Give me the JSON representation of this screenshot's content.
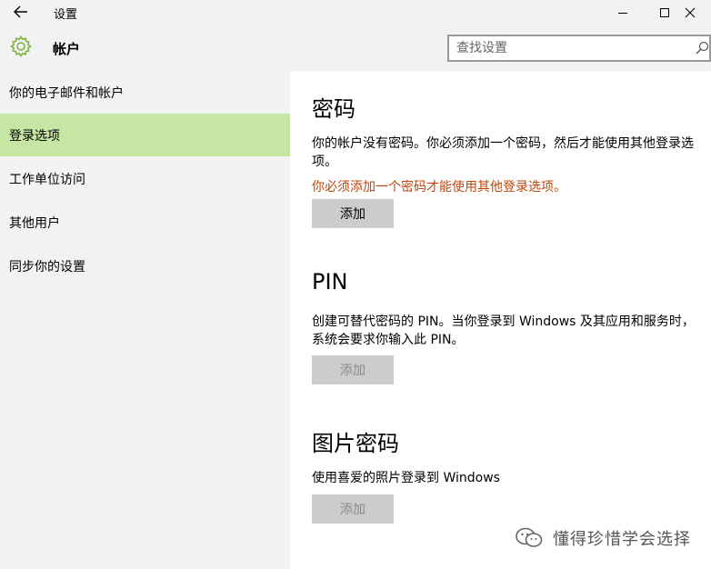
{
  "window": {
    "title": "设置"
  },
  "header": {
    "title": "帐户",
    "search_placeholder": "查找设置"
  },
  "sidebar": {
    "items": [
      {
        "label": "你的电子邮件和帐户",
        "selected": false
      },
      {
        "label": "登录选项",
        "selected": true
      },
      {
        "label": "工作单位访问",
        "selected": false
      },
      {
        "label": "其他用户",
        "selected": false
      },
      {
        "label": "同步你的设置",
        "selected": false
      }
    ]
  },
  "sections": {
    "password": {
      "heading": "密码",
      "desc": "你的帐户没有密码。你必须添加一个密码，然后才能使用其他登录选项。",
      "warning": "你必须添加一个密码才能使用其他登录选项。",
      "button": "添加",
      "button_enabled": true
    },
    "pin": {
      "heading": "PIN",
      "desc": "创建可替代密码的 PIN。当你登录到 Windows 及其应用和服务时，系统会要求你输入此 PIN。",
      "button": "添加",
      "button_enabled": false
    },
    "picture_password": {
      "heading": "图片密码",
      "desc": "使用喜爱的照片登录到 Windows",
      "button": "添加",
      "button_enabled": false
    }
  },
  "watermark": {
    "text": "懂得珍惜学会选择"
  },
  "colors": {
    "chrome_bg": "#f2f2f2",
    "selected_bg": "#c8e6a3",
    "warning_text": "#c0450a",
    "button_bg": "#cccccc",
    "gear_icon": "#7cb342"
  },
  "icons": {
    "back": "back-arrow-icon",
    "minimize": "minimize-icon",
    "maximize": "maximize-icon",
    "close": "close-icon",
    "settings": "gear-icon",
    "search": "search-icon",
    "watermark": "wechat-icon"
  }
}
